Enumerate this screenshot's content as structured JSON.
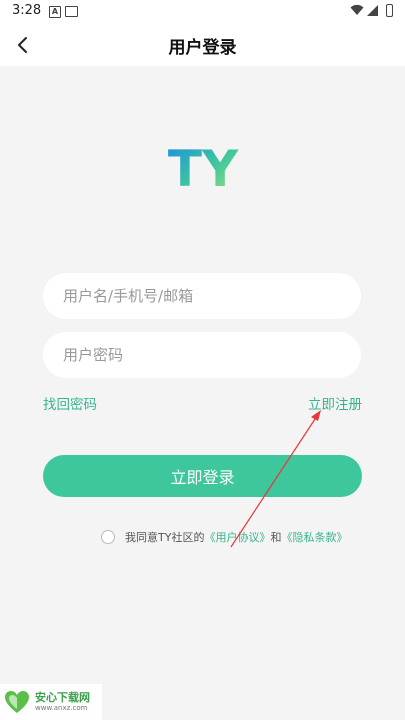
{
  "status_bar": {
    "time": "3:28",
    "icons": [
      "a-box-icon",
      "cast-icon",
      "wifi-icon",
      "signal-icon",
      "battery-icon"
    ]
  },
  "header": {
    "title": "用户登录",
    "back_icon": "chevron-left-icon"
  },
  "logo": {
    "text": "TY",
    "colors": [
      "#1a8ee0",
      "#3fc79c",
      "#a8e07a"
    ]
  },
  "form": {
    "username_placeholder": "用户名/手机号/邮箱",
    "username_value": "",
    "password_placeholder": "用户密码",
    "password_value": ""
  },
  "links": {
    "forgot": "找回密码",
    "register": "立即注册"
  },
  "login_button": "立即登录",
  "agreement": {
    "prefix": "我同意TY社区的",
    "user_agreement": "《用户协议》",
    "conjunction": "和",
    "privacy_policy": "《隐私条款》",
    "checked": false
  },
  "watermark": {
    "title": "安心下载网",
    "url": "www.anxz.com"
  },
  "colors": {
    "accent": "#3ec69c",
    "link": "#36b48e",
    "background": "#f4f4f4",
    "annotation": "#e53935"
  }
}
